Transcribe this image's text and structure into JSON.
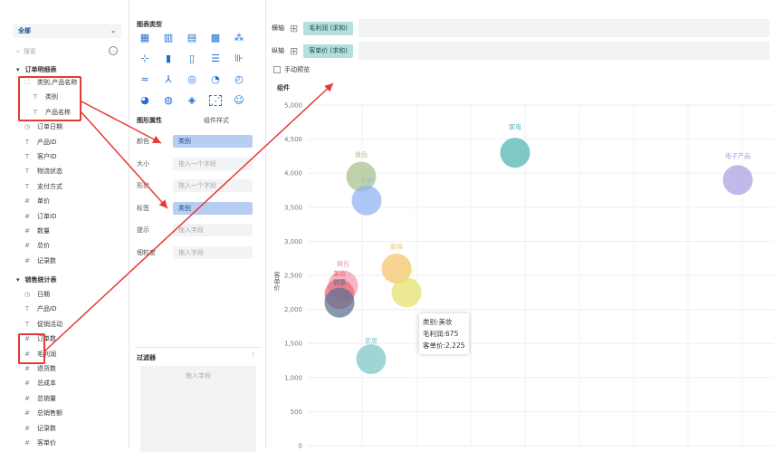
{
  "left_panel": {
    "dataset": "全部",
    "search_placeholder": "搜索",
    "group1": {
      "label": "订单明细表",
      "fields": [
        {
          "icon": "tree",
          "label": "类别,产品名称"
        },
        {
          "icon": "T",
          "label": "类别"
        },
        {
          "icon": "T",
          "label": "产品名称"
        },
        {
          "icon": "clock",
          "label": "订单日期"
        },
        {
          "icon": "T",
          "label": "产品ID"
        },
        {
          "icon": "T",
          "label": "客户ID"
        },
        {
          "icon": "T",
          "label": "物流状态"
        },
        {
          "icon": "T",
          "label": "支付方式"
        },
        {
          "icon": "#",
          "label": "单价"
        },
        {
          "icon": "#",
          "label": "订单ID"
        },
        {
          "icon": "#",
          "label": "数量"
        },
        {
          "icon": "#",
          "label": "总价"
        },
        {
          "icon": "#",
          "label": "记录数"
        }
      ]
    },
    "group2": {
      "label": "销售统计表",
      "fields": [
        {
          "icon": "clock",
          "label": "日期"
        },
        {
          "icon": "T",
          "label": "产品ID"
        },
        {
          "icon": "T",
          "label": "促销活动"
        },
        {
          "icon": "#",
          "label": "订单数"
        },
        {
          "icon": "#",
          "label": "毛利润"
        },
        {
          "icon": "#",
          "label": "退货数"
        },
        {
          "icon": "#",
          "label": "总成本"
        },
        {
          "icon": "#",
          "label": "总销量"
        },
        {
          "icon": "#",
          "label": "总销售额"
        },
        {
          "icon": "#",
          "label": "记录数"
        },
        {
          "icon": "#",
          "label": "客单价"
        }
      ]
    }
  },
  "middle_panel": {
    "chart_types_title": "图表类型",
    "attr_tab": "图形属性",
    "style_tab": "组件样式",
    "props": [
      {
        "label": "颜色",
        "value": "类别",
        "filled": true
      },
      {
        "label": "大小",
        "value": "拖入一个字段",
        "filled": false
      },
      {
        "label": "形状",
        "value": "拖入一个字段",
        "filled": false
      },
      {
        "label": "标签",
        "value": "类别",
        "filled": true
      },
      {
        "label": "提示",
        "value": "拖入字段",
        "filled": false
      },
      {
        "label": "细粒度",
        "value": "拖入字段",
        "filled": false
      }
    ],
    "filter_title": "过滤器",
    "filter_placeholder": "拖入字段"
  },
  "right_panel": {
    "x_axis_label": "横轴",
    "x_axis_field": "毛利润 (求和)",
    "y_axis_label": "纵轴",
    "y_axis_field": "客单价 (求和)",
    "manual_preview": "手动预览",
    "chart_tag": "组件"
  },
  "tooltip": {
    "line1": "类别:美妆",
    "line2": "毛利润:675",
    "line3": "客单价:2,225"
  },
  "chart_data": {
    "type": "scatter",
    "ylabel": "客单价",
    "ylim": [
      0,
      5000
    ],
    "yticks": [
      "0",
      "500",
      "1,000",
      "1,500",
      "2,000",
      "2,500",
      "3,000",
      "3,500",
      "4,000",
      "4,500",
      "5,000"
    ],
    "points": [
      {
        "label": "家电",
        "y": 4300,
        "color": "#4fb3b3"
      },
      {
        "label": "电子产品",
        "y": 3900,
        "color": "#a99ee0"
      },
      {
        "label": "食品",
        "y": 3950,
        "color": "#a6c08a"
      },
      {
        "label": "个护",
        "y": 3600,
        "color": "#8fb1f2"
      },
      {
        "label": "厨具",
        "y": 2600,
        "color": "#f5c46a"
      },
      {
        "label": "运动",
        "y": 2250,
        "color": "#e3e06b"
      },
      {
        "label": "箱包",
        "y": 2350,
        "color": "#ef9aaa"
      },
      {
        "label": "美妆",
        "y": 2225,
        "color": "#e56a7c"
      },
      {
        "label": "健康",
        "y": 2100,
        "color": "#5a7090"
      },
      {
        "label": "家居",
        "y": 1270,
        "color": "#7dc5c5"
      }
    ]
  }
}
